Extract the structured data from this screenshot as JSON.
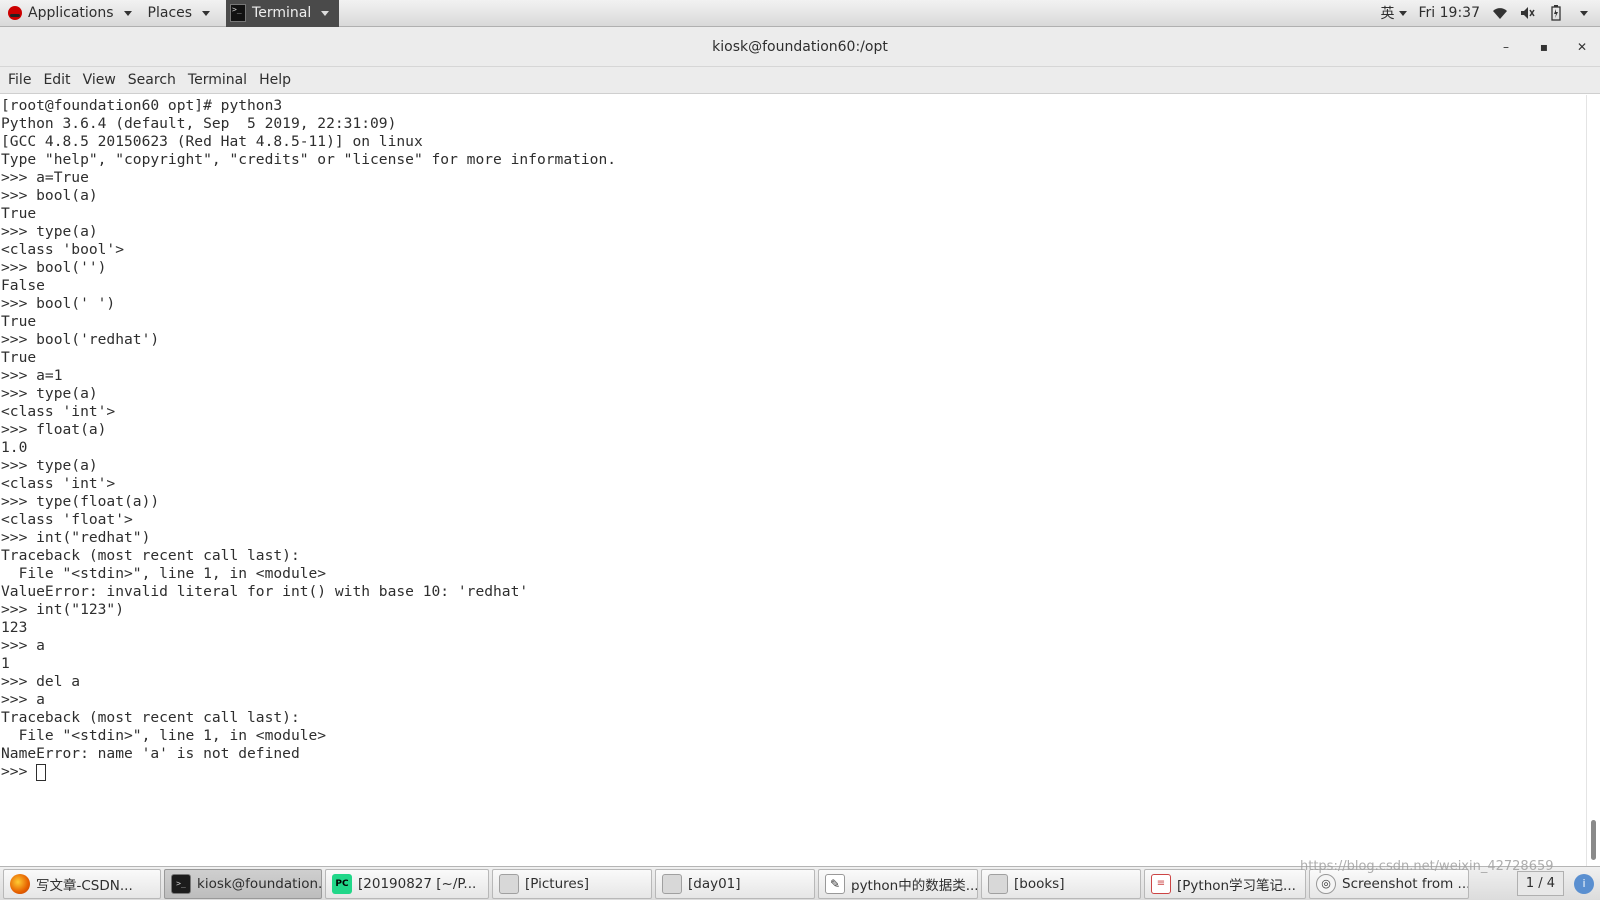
{
  "top_panel": {
    "applications_label": "Applications",
    "places_label": "Places",
    "active_app_label": "Terminal",
    "input_method": "英",
    "clock": "Fri 19:37"
  },
  "window": {
    "title": "kiosk@foundation60:/opt",
    "minimize_glyph": "–",
    "maximize_glyph": "▪",
    "close_glyph": "✕"
  },
  "menu": [
    "File",
    "Edit",
    "View",
    "Search",
    "Terminal",
    "Help"
  ],
  "terminal_lines": [
    "[root@foundation60 opt]# python3",
    "Python 3.6.4 (default, Sep  5 2019, 22:31:09)",
    "[GCC 4.8.5 20150623 (Red Hat 4.8.5-11)] on linux",
    "Type \"help\", \"copyright\", \"credits\" or \"license\" for more information.",
    ">>> a=True",
    ">>> bool(a)",
    "True",
    ">>> type(a)",
    "<class 'bool'>",
    ">>> bool('')",
    "False",
    ">>> bool(' ')",
    "True",
    ">>> bool('redhat')",
    "True",
    ">>> a=1",
    ">>> type(a)",
    "<class 'int'>",
    ">>> float(a)",
    "1.0",
    ">>> type(a)",
    "<class 'int'>",
    ">>> type(float(a))",
    "<class 'float'>",
    ">>> int(\"redhat\")",
    "Traceback (most recent call last):",
    "  File \"<stdin>\", line 1, in <module>",
    "ValueError: invalid literal for int() with base 10: 'redhat'",
    ">>> int(\"123\")",
    "123",
    ">>> a",
    "1",
    ">>> del a",
    ">>> a",
    "Traceback (most recent call last):",
    "  File \"<stdin>\", line 1, in <module>",
    "NameError: name 'a' is not defined"
  ],
  "current_prompt": ">>> ",
  "taskbar": {
    "tasks": [
      {
        "label": "写文章-CSDN...",
        "icon": "firefox-icon",
        "active": false
      },
      {
        "label": "kiosk@foundation...",
        "icon": "terminal-icon",
        "active": true
      },
      {
        "label": "[20190827 [~/P...",
        "icon": "pycharm-icon",
        "active": false
      },
      {
        "label": "[Pictures]",
        "icon": "folder-icon",
        "active": false
      },
      {
        "label": "[day01]",
        "icon": "folder-icon",
        "active": false
      },
      {
        "label": "python中的数据类...",
        "icon": "text-editor-icon",
        "active": false
      },
      {
        "label": "[books]",
        "icon": "folder-icon",
        "active": false
      },
      {
        "label": "[Python学习笔记...",
        "icon": "document-icon",
        "active": false
      },
      {
        "label": "Screenshot from ...",
        "icon": "screenshot-icon",
        "active": false
      }
    ],
    "workspace": "1 / 4"
  },
  "watermark": "https://blog.csdn.net/weixin_42728659"
}
